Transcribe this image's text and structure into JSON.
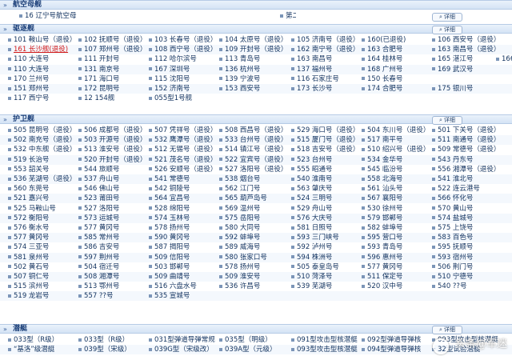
{
  "detail_label": "详细",
  "sections": [
    {
      "title": "航空母舰",
      "rows": [
        [
          "16 辽宁号航空母舰",
          "",
          "",
          "第二艘航空母舰"
        ]
      ]
    },
    {
      "title": "驱逐舰",
      "rows": [
        [
          "101 鞍山号（退役）",
          "102 抚顺号（退役）",
          "103 长春号（退役）",
          "104 太原号（退役）",
          "105 济南号（退役）",
          "160(已退役)",
          "106 西安号（退役）"
        ],
        [
          "161 长沙舰(退役)",
          "107 郑州号（退役）",
          "108 西宁号（退役）",
          "109 开封号（退役）",
          "162 南宁号（退役）",
          "163 合肥号",
          "163 南昌号（退役）"
        ],
        [
          "110 大连号",
          "111 开封号",
          "112 哈尔滨号",
          "113 青岛号",
          "163 南昌号",
          "164 桂林号",
          "165 湛江号",
          "166 珠海号"
        ],
        [
          "110 大连号",
          "131 南京号",
          "167 深圳号",
          "136 杭州号",
          "137 福州号",
          "168 广州号",
          "169 武汉号",
          ""
        ],
        [
          "170 兰州号",
          "171 海口号",
          "115 沈阳号",
          "139 宁波号",
          "116 石家庄号",
          "150 长春号",
          "",
          ""
        ],
        [
          "151 郑州号",
          "172 昆明号",
          "152 济南号",
          "153 西安号",
          "173 长沙号",
          "174 合肥号",
          "175 银川号",
          ""
        ],
        [
          "117 西宁号",
          "12 154舰",
          "055型1号舰",
          "",
          "",
          "",
          "",
          ""
        ]
      ]
    },
    {
      "title": "护卫舰",
      "rows": [
        [
          "505 昆明号（退役）",
          "506 成都号（退役）",
          "507 凭祥号（退役）",
          "508 西昌号（退役）",
          "529 海口号（退役）",
          "504 东川号（退役）",
          "501 下关号（退役）"
        ],
        [
          "502 南充号（退役）",
          "503 开源号（退役）",
          "532 鹰潭号（退役）",
          "533 台州号（退役）",
          "515 厦门号（退役）",
          "517 南平号",
          "511 南通号（退役）"
        ],
        [
          "532 中东舰（退役）",
          "513 淮安号（退役）",
          "512 无锡号（退役）",
          "514 镇江号（退役）",
          "518 吉安号（退役）",
          "510 绍兴号（退役）",
          "509 常德号（退役）"
        ],
        [
          "519 长治号",
          "520 开封号（退役）",
          "521 茂名号（退役）",
          "522 宜宾号（退役）",
          "523 台州号",
          "534 金华号",
          "543 丹东号"
        ],
        [
          "553 韶关号",
          "544 旅顺号",
          "526 安顺号（退役）",
          "527 洛阳号（退役）",
          "555 昭通号",
          "545 临汾号",
          "556 湘潭号（退役）"
        ],
        [
          "536 芜湖号（退役）",
          "537 舟山号",
          "541 常德号",
          "538 烟台号",
          "540 淮南号",
          "558 北海号",
          "541 淮北号"
        ],
        [
          "560 东莞号",
          "546 佛山号",
          "542 铜陵号",
          "562 江门号",
          "563 肇庆号",
          "561 汕头号",
          "522 连云港号"
        ],
        [
          "521 嘉兴号",
          "523 莆田号",
          "564 宜昌号",
          "565 葫芦岛号",
          "524 三明号",
          "567 襄阳号",
          "566 怀化号"
        ],
        [
          "525 马鞍山号",
          "527 洛阳号",
          "528 绵阳号",
          "569 温州号",
          "529 舟山号",
          "530 徐州号",
          "570 黄山号"
        ],
        [
          "572 衡阳号",
          "573 运城号",
          "574 玉林号",
          "575 岳阳号",
          "576 大庆号",
          "579 邯郸号",
          "574 盐城号"
        ],
        [
          "576 衡水号",
          "577 黄冈号",
          "578 扬州号",
          "580 大同号",
          "581 日照号",
          "582 蚌埠号",
          "575 上饶号"
        ],
        [
          "577 黄冈号",
          "585 常州号",
          "590 黄冈号",
          "592 蚌埠号",
          "593 三门峡号",
          "595 营口号",
          "583 百色号"
        ],
        [
          "574 三亚号",
          "586 吉安号",
          "587 揭阳号",
          "589 威海号",
          "592 泸州号",
          "593 青岛号",
          "595 抚顺号"
        ],
        [
          "581 泉州号",
          "597 荆州号",
          "509 信阳号",
          "580 张家口号",
          "594 株洲号",
          "596 惠州号",
          "593 宿州号"
        ],
        [
          "502 黄石号",
          "504 宿迁号",
          "503 邯郸号",
          "578 扬州号",
          "505 泰皇岛号",
          "577 黄冈号",
          "506 荆门号"
        ],
        [
          "507 铜仁号",
          "508 湘潭号",
          "509 曲靖号",
          "509 淮安号",
          "510 菏泽号",
          "511 保定号",
          "510 宁德号"
        ],
        [
          "515 滨州号",
          "513 鄂州号",
          "516 六盘水号",
          "536 许昌号",
          "539 芜湖号",
          "520 汉中号",
          "540 ??号"
        ],
        [
          "519 龙岩号",
          "557 ??号",
          "535 宣城号",
          "",
          "",
          "",
          ""
        ]
      ]
    },
    {
      "title": "潜艇",
      "rows": [
        [
          "033型（R级）",
          "033型（R级）",
          "031型弹道导弹常规",
          "035型（明级）",
          "091型攻击型核潜艇",
          "092型弹道导弹核",
          "093型攻击型核潜艇"
        ],
        [
          "“基洛”级潜艇",
          "039型（宋级）",
          "039G型（宋级改）",
          "039A型（元级）",
          "093型攻击型核潜艇",
          "094型弹道导弹核",
          "32型试验潜艇"
        ]
      ]
    }
  ],
  "watermark": "头条@军迷"
}
